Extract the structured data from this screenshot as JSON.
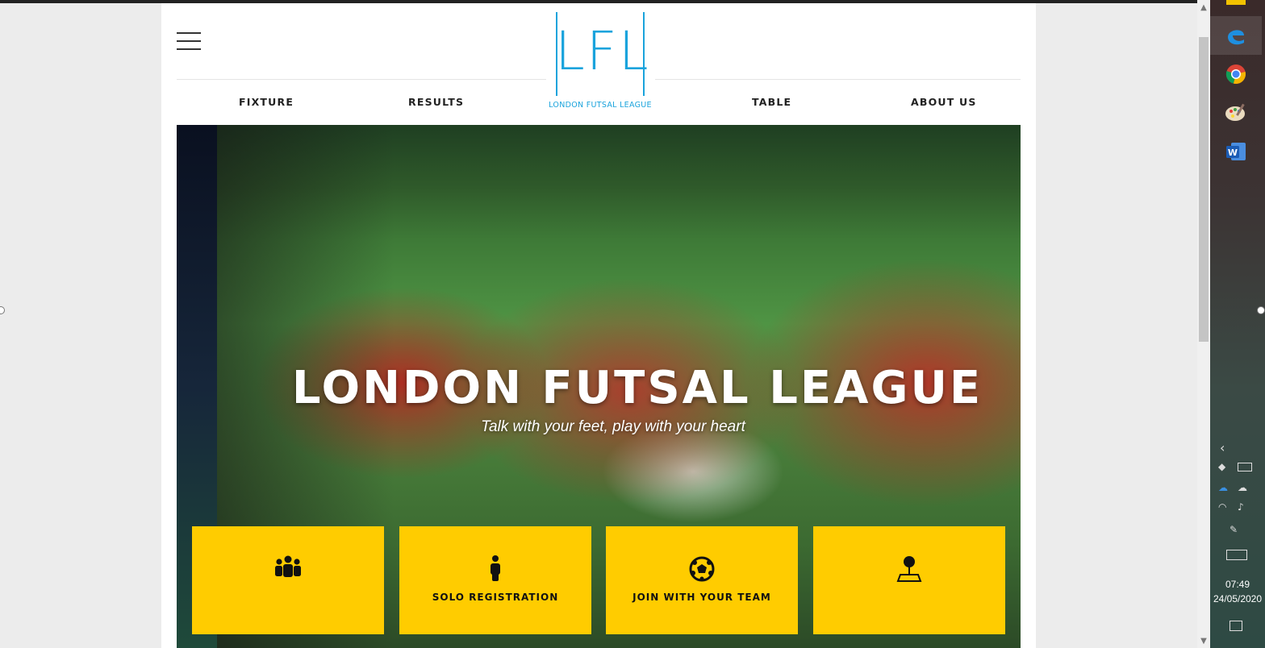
{
  "logo": {
    "mark": "LFL",
    "subtitle": "LONDON FUTSAL LEAGUE"
  },
  "nav": {
    "items": [
      "FIXTURE",
      "RESULTS",
      "TABLE",
      "ABOUT US"
    ]
  },
  "hero": {
    "title": "LONDON FUTSAL LEAGUE",
    "tagline": "Talk with your feet, play with your heart"
  },
  "tiles": [
    {
      "icon": "group-icon",
      "label": ""
    },
    {
      "icon": "person-icon",
      "label": "SOLO REGISTRATION"
    },
    {
      "icon": "football-icon",
      "label": "JOIN WITH YOUR TEAM"
    },
    {
      "icon": "location-pin-icon",
      "label": ""
    }
  ],
  "taskbar": {
    "apps": [
      "edge-icon",
      "chrome-icon",
      "paint-icon",
      "word-icon"
    ],
    "time": "07:49",
    "date": "24/05/2020"
  },
  "colors": {
    "accent": "#1aa3dc",
    "tile": "#ffcc00"
  }
}
